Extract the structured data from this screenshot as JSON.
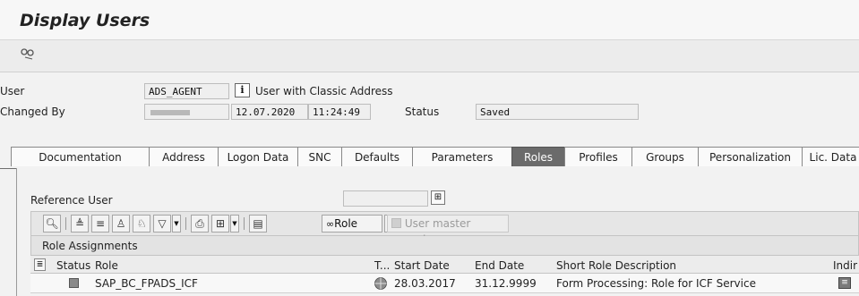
{
  "title": "Display Users",
  "toolbar": {
    "icon": "glasses-icon"
  },
  "user_field": {
    "label": "User",
    "value": "ADS_AGENT",
    "address_label": "User with Classic Address"
  },
  "changed_by": {
    "label": "Changed By",
    "date": "12.07.2020",
    "time": "11:24:49",
    "status_label": "Status",
    "status_value": "Saved"
  },
  "tabs": [
    "Documentation",
    "Address",
    "Logon Data",
    "SNC",
    "Defaults",
    "Parameters",
    "Roles",
    "Profiles",
    "Groups",
    "Personalization",
    "Lic. Data"
  ],
  "active_tab": "Roles",
  "reference_user": {
    "label": "Reference User",
    "value": ""
  },
  "role_toolbar": {
    "role_button": "Role",
    "user_master_button": "User master record"
  },
  "role_assignments": {
    "title": "Role Assignments",
    "columns": [
      "Status",
      "Role",
      "T...",
      "Start Date",
      "End Date",
      "Short Role Description",
      "Indir"
    ],
    "rows": [
      {
        "role": "SAP_BC_FPADS_ICF",
        "start": "28.03.2017",
        "end": "31.12.9999",
        "description": "Form Processing: Role for ICF Service"
      }
    ]
  },
  "colors": {
    "active_tab": "#6b6b6b",
    "background": "#f2f2f2"
  }
}
